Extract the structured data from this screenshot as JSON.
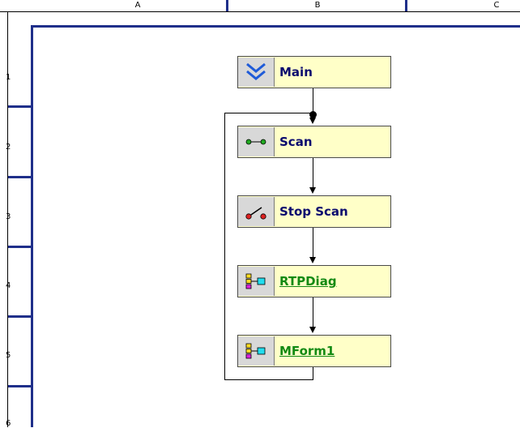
{
  "columns": [
    "A",
    "B",
    "C"
  ],
  "rows": [
    "1",
    "2",
    "3",
    "4",
    "5",
    "6"
  ],
  "nodes": [
    {
      "label": "Main",
      "icon": "chevron-down-icon"
    },
    {
      "label": "Scan",
      "icon": "scan-node-icon"
    },
    {
      "label": "Stop Scan",
      "icon": "stop-scan-icon"
    },
    {
      "label": "RTPDiag",
      "icon": "subprogram-icon"
    },
    {
      "label": "MForm1",
      "icon": "subprogram-icon"
    }
  ],
  "colors": {
    "grid_lines": "#1f2f8a",
    "node_fill": "#ffffc8",
    "node_text": "#0a0a6e",
    "link_text": "#138a13"
  }
}
